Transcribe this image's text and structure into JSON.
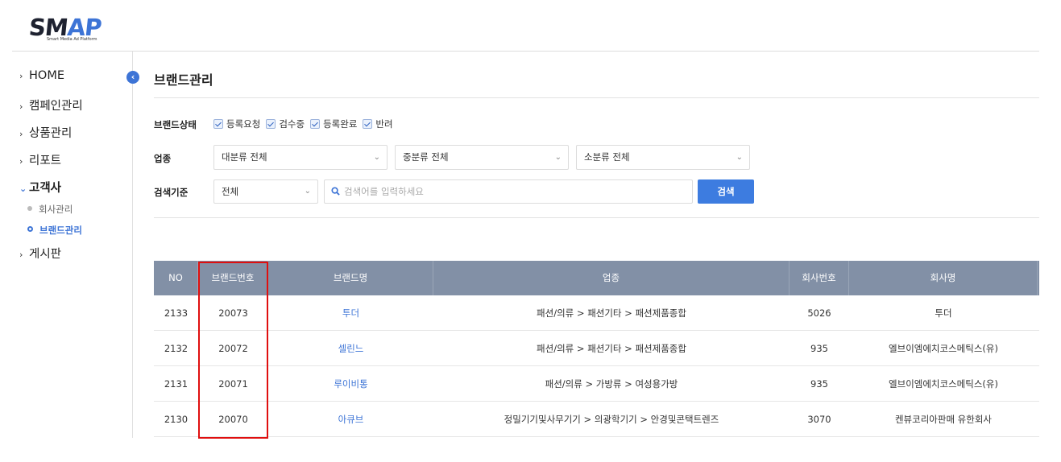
{
  "logo": {
    "text_main": "SM",
    "text_accent": "AP",
    "subtitle": "Smart Media Ad Platform"
  },
  "sidebar": {
    "collapse_glyph": "‹",
    "items": [
      {
        "label": "HOME",
        "chevron": "›"
      },
      {
        "label": "캠페인관리",
        "chevron": "›"
      },
      {
        "label": "상품관리",
        "chevron": "›"
      },
      {
        "label": "리포트",
        "chevron": "›"
      },
      {
        "label": "고객사",
        "chevron": "⌄",
        "open": true
      },
      {
        "label": "게시판",
        "chevron": "›"
      }
    ],
    "sub_items": [
      {
        "label": "회사관리",
        "active": false
      },
      {
        "label": "브랜드관리",
        "active": true
      }
    ]
  },
  "page": {
    "title": "브랜드관리"
  },
  "filters": {
    "status_label": "브랜드상태",
    "status_options": [
      {
        "label": "등록요청",
        "checked": true
      },
      {
        "label": "검수중",
        "checked": true
      },
      {
        "label": "등록완료",
        "checked": true
      },
      {
        "label": "반려",
        "checked": true
      }
    ],
    "industry_label": "업종",
    "industry_selects": [
      "대분류 전체",
      "중분류 전체",
      "소분류 전체"
    ],
    "criteria_label": "검색기준",
    "criteria_select": "전체",
    "search_placeholder": "검색어를 입력하세요",
    "search_button": "검색",
    "caret": "⌄"
  },
  "table": {
    "columns": [
      "NO",
      "브랜드번호",
      "브랜드명",
      "업종",
      "회사번호",
      "회사명"
    ],
    "rows": [
      {
        "no": "2133",
        "brand_no": "20073",
        "brand_name": "투더",
        "industry": "패션/의류 > 패션기타 > 패션제품종합",
        "company_no": "5026",
        "company_name": "투더"
      },
      {
        "no": "2132",
        "brand_no": "20072",
        "brand_name": "셀린느",
        "industry": "패션/의류 > 패션기타 > 패션제품종합",
        "company_no": "935",
        "company_name": "엘브이엠에치코스메틱스(유)"
      },
      {
        "no": "2131",
        "brand_no": "20071",
        "brand_name": "루이비통",
        "industry": "패션/의류 > 가방류 > 여성용가방",
        "company_no": "935",
        "company_name": "엘브이엠에치코스메틱스(유)"
      },
      {
        "no": "2130",
        "brand_no": "20070",
        "brand_name": "아큐브",
        "industry": "정밀기기및사무기기 > 의광학기기 > 안경및콘택트렌즈",
        "company_no": "3070",
        "company_name": "켄뷰코리아판매 유한회사"
      }
    ]
  },
  "colors": {
    "accent": "#3d74d6",
    "header_bg": "#8290a6",
    "highlight": "#e00f0f"
  }
}
